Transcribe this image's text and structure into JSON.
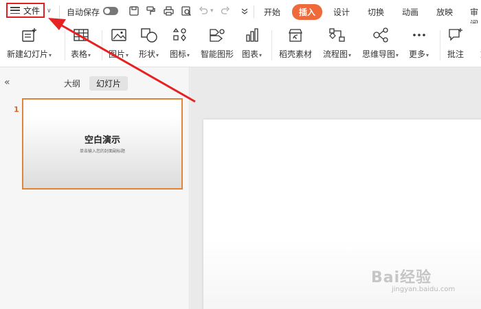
{
  "topbar": {
    "file_label": "文件",
    "autosave_label": "自动保存",
    "tabs": [
      "开始",
      "插入",
      "设计",
      "切换",
      "动画",
      "放映",
      "审阅"
    ],
    "active_tab_index": 1,
    "accent_color": "#ee6a3a"
  },
  "ribbon": {
    "items": [
      {
        "label": "新建幻灯片",
        "icon": "new-slide-icon",
        "dropdown": true
      },
      {
        "label": "表格",
        "icon": "table-icon",
        "dropdown": true
      },
      {
        "label": "图片",
        "icon": "picture-icon",
        "dropdown": true
      },
      {
        "label": "形状",
        "icon": "shape-icon",
        "dropdown": true
      },
      {
        "label": "图标",
        "icon": "icons-icon",
        "dropdown": true
      },
      {
        "label": "智能图形",
        "icon": "smart-graphic-icon",
        "dropdown": false
      },
      {
        "label": "图表",
        "icon": "chart-icon",
        "dropdown": true
      },
      {
        "label": "稻壳素材",
        "icon": "docer-material-icon",
        "dropdown": false
      },
      {
        "label": "流程图",
        "icon": "flowchart-icon",
        "dropdown": true
      },
      {
        "label": "思维导图",
        "icon": "mindmap-icon",
        "dropdown": true
      },
      {
        "label": "更多",
        "icon": "more-icon",
        "dropdown": true
      },
      {
        "label": "批注",
        "icon": "comment-icon",
        "dropdown": false
      },
      {
        "label": "文",
        "icon": "textbox-icon",
        "dropdown": false
      }
    ]
  },
  "panel": {
    "tabs": [
      "大纲",
      "幻灯片"
    ],
    "active_tab_index": 1,
    "slide_number": "1",
    "slide_title": "空白演示",
    "slide_subtitle": "单击输入您的封面副标题"
  },
  "watermark": {
    "brand": "Bai经验",
    "domain": "jingyan.baidu.com"
  }
}
